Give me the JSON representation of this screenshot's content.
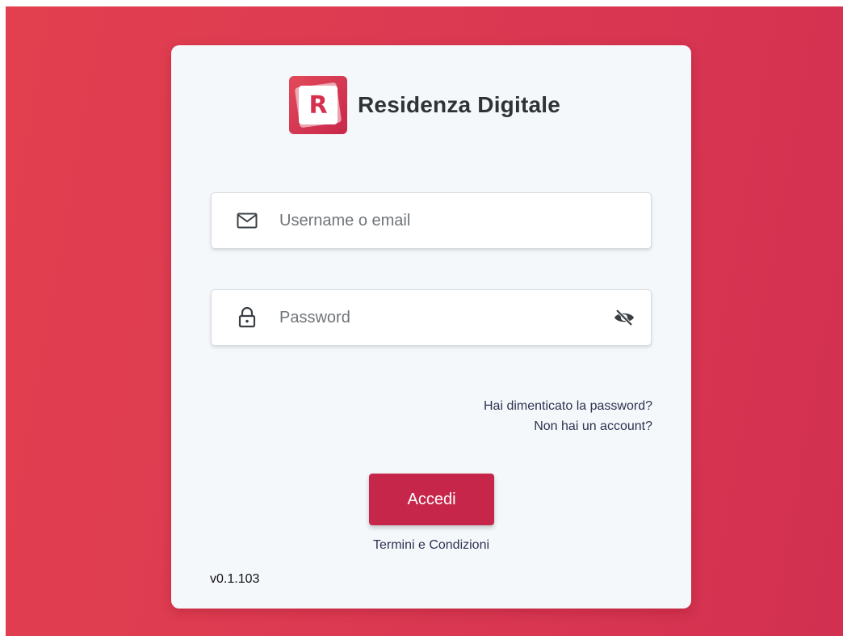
{
  "brand": {
    "logo_letter": "R",
    "name": "Residenza Digitale",
    "accent_color": "#d7304e"
  },
  "form": {
    "username": {
      "icon": "mail-icon",
      "placeholder": "Username o email",
      "value": ""
    },
    "password": {
      "icon": "lock-icon",
      "placeholder": "Password",
      "value": "",
      "toggle_icon": "eye-off-icon"
    }
  },
  "links": {
    "forgot_password": "Hai dimenticato la password?",
    "no_account": "Non hai un account?"
  },
  "login_button": {
    "label": "Accedi",
    "color": "#c6264a"
  },
  "terms_link": "Termini e Condizioni",
  "version": "v0.1.103"
}
